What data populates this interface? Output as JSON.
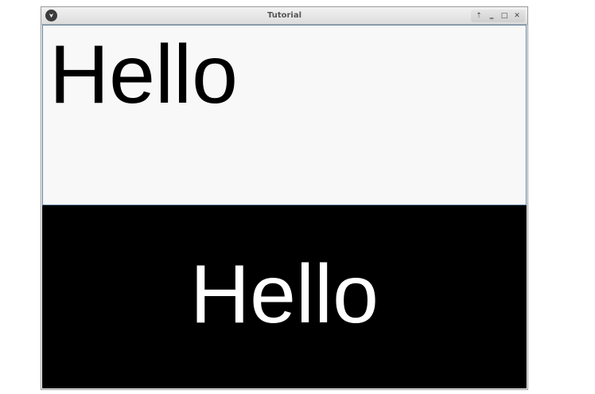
{
  "window": {
    "title": "Tutorial",
    "app_icon": "kivy-logo-icon",
    "controls": {
      "pin_label": "⇡",
      "minimize_label": "‗",
      "maximize_label": "□",
      "close_label": "✕"
    }
  },
  "top_label": {
    "text": "Hello",
    "text_color": "#000000",
    "background_color": "#f8f8f8"
  },
  "bottom_label": {
    "text": "Hello",
    "text_color": "#ffffff",
    "background_color": "#000000"
  }
}
